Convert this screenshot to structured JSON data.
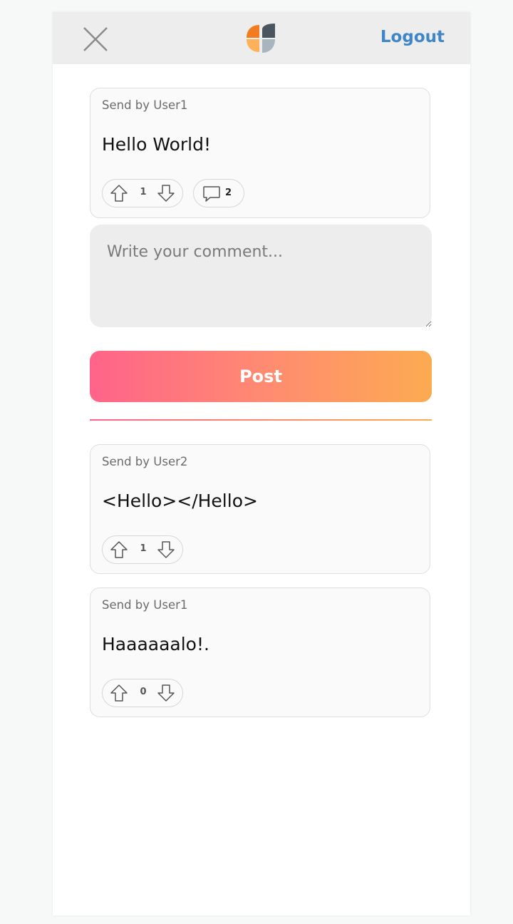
{
  "header": {
    "logout_label": "Logout"
  },
  "post": {
    "author": "Send by User1",
    "message": "Hello World!",
    "votes": "1",
    "comments": "2"
  },
  "composer": {
    "placeholder": "Write your comment...",
    "post_label": "Post"
  },
  "comments": [
    {
      "author": "Send by User2",
      "message": "<Hello></Hello>",
      "votes": "1"
    },
    {
      "author": "Send by User1",
      "message": "Haaaaaalo!.",
      "votes": "0"
    }
  ],
  "colors": {
    "accent": "#3f86c7",
    "gradient_start": "#ff6389",
    "gradient_end": "#fcab51",
    "logo_orange": "#f47c20",
    "logo_light_orange": "#fdb25a",
    "logo_dark": "#4a5560",
    "logo_light": "#a8b4be"
  },
  "icons": {
    "close": "close-icon",
    "logo": "app-logo",
    "upvote": "arrow-up-icon",
    "downvote": "arrow-down-icon",
    "comment": "comment-bubble-icon"
  }
}
